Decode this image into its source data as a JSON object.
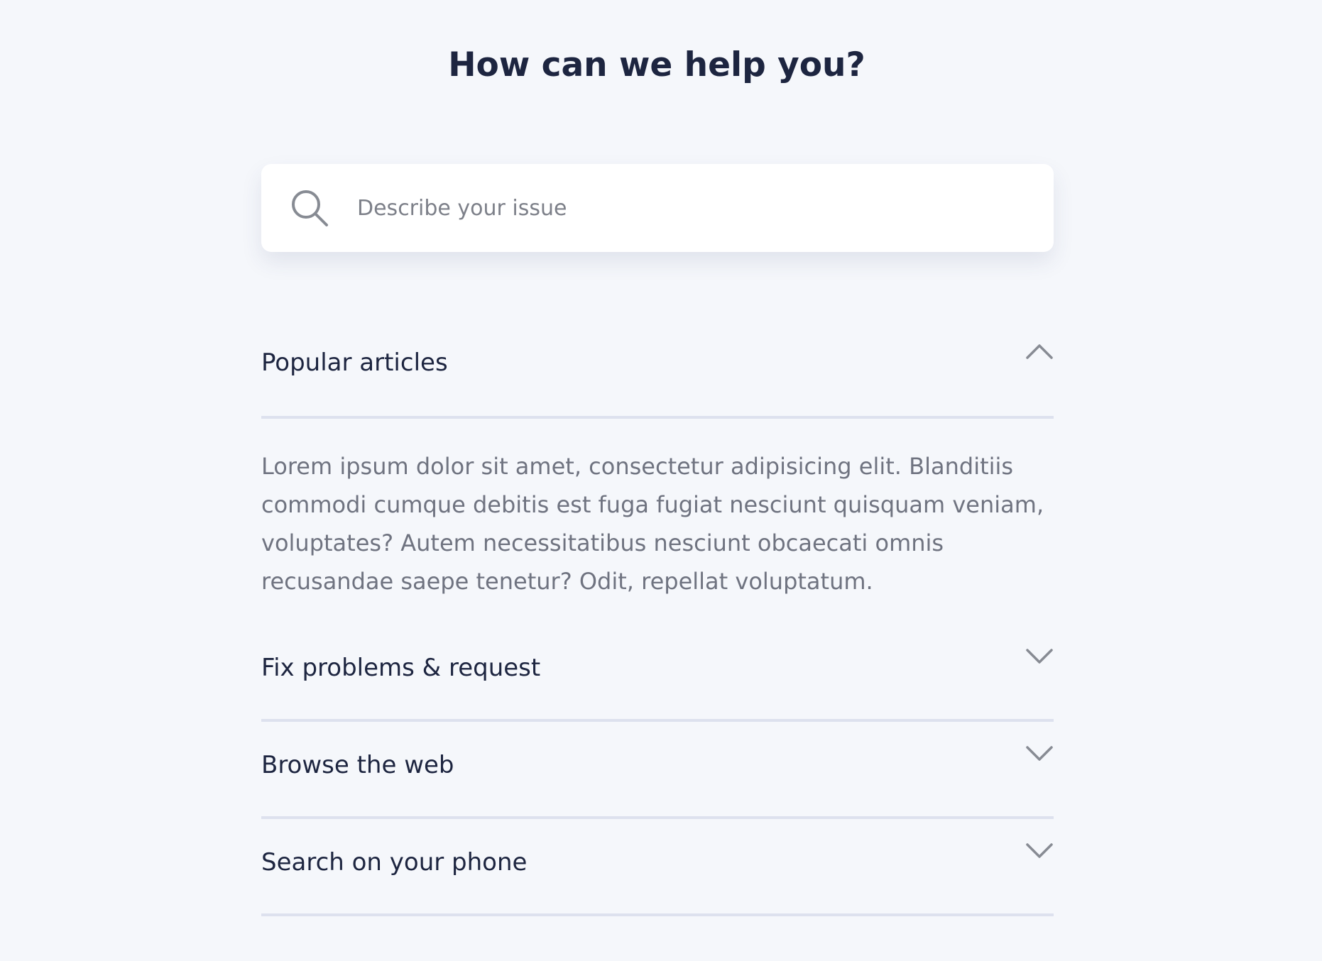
{
  "header": {
    "title": "How can we help you?"
  },
  "search": {
    "icon": "search-icon",
    "placeholder": "Describe your issue",
    "value": ""
  },
  "accordion": {
    "items": [
      {
        "label": "Popular articles",
        "expanded": true,
        "icon": "chevron-up-icon",
        "body": "Lorem ipsum dolor sit amet, consectetur adipisicing elit. Blanditiis commodi cumque debitis est fuga fugiat nesciunt quisquam veniam, voluptates? Autem necessitatibus nesciunt obcaecati omnis recusandae saepe tenetur? Odit, repellat voluptatum."
      },
      {
        "label": "Fix problems & request",
        "expanded": false,
        "icon": "chevron-down-icon"
      },
      {
        "label": "Browse the web",
        "expanded": false,
        "icon": "chevron-down-icon"
      },
      {
        "label": "Search on your phone",
        "expanded": false,
        "icon": "chevron-down-icon"
      }
    ]
  },
  "colors": {
    "background": "#f5f7fb",
    "heading": "#1d2540",
    "body_text": "#6f7380",
    "divider": "#dde1ee",
    "icon": "#878b93"
  }
}
